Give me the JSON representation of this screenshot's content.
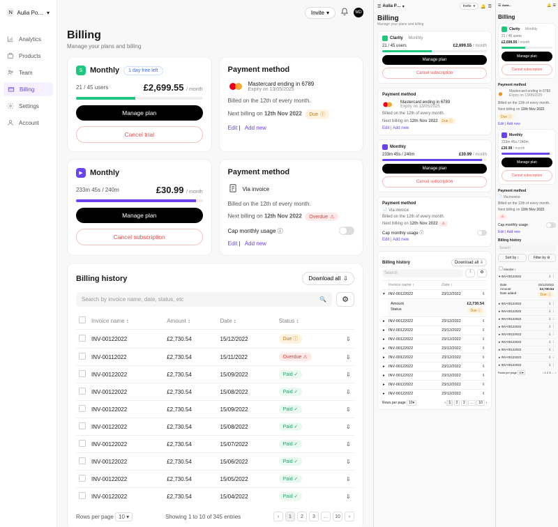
{
  "workspace": {
    "initial": "N",
    "name": "Aulia Post…",
    "invite": "Invite",
    "avatar": "MD"
  },
  "sidebar": {
    "items": [
      {
        "label": "Analytics"
      },
      {
        "label": "Products"
      },
      {
        "label": "Team"
      },
      {
        "label": "Billing"
      },
      {
        "label": "Settings"
      },
      {
        "label": "Account"
      }
    ]
  },
  "page": {
    "title": "Billing",
    "subtitle": "Manage your plans and billing"
  },
  "plan1": {
    "name": "Monthly",
    "trial": "1 day free left",
    "usage": "21 / 45 users",
    "price": "£2,699.55",
    "per": "/ month",
    "manage": "Manage plan",
    "cancel": "Cancel trial",
    "pm_title": "Payment method",
    "pm_line": "Mastercard ending in 6789",
    "pm_expiry": "Expiry on 13/05/2025",
    "note1": "Billed on the 12th of every month.",
    "note2a": "Next billing on ",
    "note2b": "12th Nov 2022",
    "due": "Due",
    "edit": "Edit",
    "add": "Add new"
  },
  "plan2": {
    "name": "Monthly",
    "usage": "233m 45s / 240m",
    "price": "£30.99",
    "per": "/ month",
    "manage": "Manage plan",
    "cancel": "Cancel subscription",
    "pm_title": "Payment method",
    "pm_line": "Via invoice",
    "note1": "Billed on the 12th of every month.",
    "note2a": "Next billing on ",
    "note2b": "12th Nov 2022",
    "overdue": "Overdue",
    "cap": "Cap monthly usage",
    "edit": "Edit",
    "add": "Add new"
  },
  "history": {
    "title": "Billing history",
    "download_all": "Download all",
    "search": "Search by invoice name, date, status, etc",
    "cols": {
      "name": "Invoice name",
      "amount": "Amount",
      "date": "Date",
      "status": "Status"
    },
    "rows": [
      {
        "name": "INV-00122022",
        "amount": "£2,730.54",
        "date": "15/12/2022",
        "status": "Due",
        "status_type": "due"
      },
      {
        "name": "INV-00112022",
        "amount": "£2,730.54",
        "date": "15/11/2022",
        "status": "Overdue",
        "status_type": "overdue"
      },
      {
        "name": "INV-00122022",
        "amount": "£2,730.54",
        "date": "15/09/2022",
        "status": "Paid",
        "status_type": "paid"
      },
      {
        "name": "INV-00122022",
        "amount": "£2,730.54",
        "date": "15/08/2022",
        "status": "Paid",
        "status_type": "paid"
      },
      {
        "name": "INV-00122022",
        "amount": "£2,730.54",
        "date": "15/09/2022",
        "status": "Paid",
        "status_type": "paid"
      },
      {
        "name": "INV-00122022",
        "amount": "£2,730.54",
        "date": "15/08/2022",
        "status": "Paid",
        "status_type": "paid"
      },
      {
        "name": "INV-00122022",
        "amount": "£2,730.54",
        "date": "15/07/2022",
        "status": "Paid",
        "status_type": "paid"
      },
      {
        "name": "INV-00122022",
        "amount": "£2,730.54",
        "date": "15/06/2022",
        "status": "Paid",
        "status_type": "paid"
      },
      {
        "name": "INV-00122022",
        "amount": "£2,730.54",
        "date": "15/05/2022",
        "status": "Paid",
        "status_type": "paid"
      },
      {
        "name": "INV-00122022",
        "amount": "£2,730.54",
        "date": "15/04/2022",
        "status": "Paid",
        "status_type": "paid"
      }
    ],
    "rows_per_page": "Rows per page",
    "rpp_val": "10",
    "showing": "Showing 1 to 10 of 345 entries",
    "pages": [
      "1",
      "2",
      "3",
      "…",
      "10"
    ]
  },
  "mobile": {
    "ws": "Aulía P…",
    "clarity": "Clarity",
    "monthly": "Monthly",
    "cancel_sub": "Cancel subscription",
    "invoice_via": "Via invoice",
    "sortby": "Sort by",
    "filterby": "Filter by",
    "invoice": "Invoice",
    "amount": "Amount",
    "date": "Date",
    "date_added": "Date added",
    "status": "Status",
    "rows": [
      {
        "name": "INV-00122022",
        "date": "23/12/2022"
      },
      {
        "name": "INV-00122022",
        "date": "23/12/2022"
      },
      {
        "name": "INV-00122022",
        "date": "23/12/2022"
      },
      {
        "name": "INV-00122022",
        "date": "23/12/2022"
      },
      {
        "name": "INV-00122022",
        "date": "23/12/2022"
      },
      {
        "name": "INV-00122022",
        "date": "23/12/2022"
      },
      {
        "name": "INV-00122022",
        "date": "23/12/2022"
      },
      {
        "name": "INV-00122022",
        "date": "23/12/2022"
      },
      {
        "name": "INV-00122022",
        "date": "23/12/2022"
      },
      {
        "name": "INV-00122022",
        "date": "23/12/2022"
      }
    ],
    "expand_amount": "£2,730.54",
    "expand_date": "23/12/2022",
    "expand_status": "Due"
  }
}
